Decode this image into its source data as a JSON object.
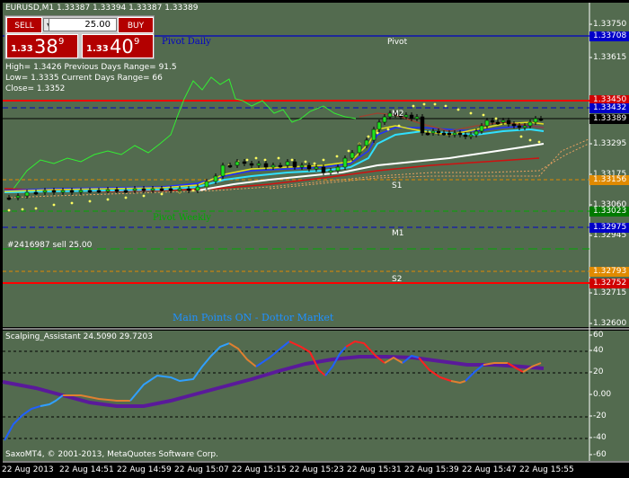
{
  "header": {
    "symbol_line": "EURUSD,M1  1.33387 1.33394 1.33387 1.33389"
  },
  "trade_panel": {
    "sell_label": "SELL",
    "buy_label": "BUY",
    "lots_value": "25.00",
    "sell_price_small": "1.33",
    "sell_price_big": "38",
    "sell_price_sup": "9",
    "buy_price_small": "1.33",
    "buy_price_big": "40",
    "buy_price_sup": "9"
  },
  "info": {
    "line1": "High= 1.3426     Previous Days Range= 91.5",
    "line2": "Low= 1.3335      Current Days Range= 66",
    "line3": "Close= 1.3352"
  },
  "labels": {
    "pivot_daily": "Pivot Daily",
    "pivot": "Pivot",
    "m2": "M2",
    "s1": "S1",
    "pivot_weekly": "Pivot Weekly",
    "m1": "M1",
    "order": "#2416987 sell 25.00",
    "s2": "S2",
    "main_points": "Main Points ON - Dottor Market",
    "indicator": "Scalping_Assistant 24.5090 29.7203",
    "copyright": "SaxoMT4, © 2001-2013, MetaQuotes Software Corp."
  },
  "price_axis": [
    "1.33750",
    "1.33615",
    "1.33295",
    "1.33175",
    "1.33060",
    "1.32945",
    "1.32715",
    "1.32600"
  ],
  "price_badges": [
    {
      "text": "1.33708",
      "bg": "#0000c8"
    },
    {
      "text": "1.33450",
      "bg": "#d00000"
    },
    {
      "text": "1.33432",
      "bg": "#0000c8"
    },
    {
      "text": "1.33389",
      "bg": "#000000"
    },
    {
      "text": "1.33156",
      "bg": "#e08a00"
    },
    {
      "text": "1.33023",
      "bg": "#007a00"
    },
    {
      "text": "1.32975",
      "bg": "#0000c8"
    },
    {
      "text": "1.32793",
      "bg": "#e08a00"
    },
    {
      "text": "1.32752",
      "bg": "#d00000"
    }
  ],
  "indicator_axis": [
    "60",
    "40",
    "20",
    "0.00",
    "-20",
    "-40",
    "-60"
  ],
  "time_axis": [
    "22 Aug 2013",
    "22 Aug 14:51",
    "22 Aug 14:59",
    "22 Aug 15:07",
    "22 Aug 15:15",
    "22 Aug 15:23",
    "22 Aug 15:31",
    "22 Aug 15:39",
    "22 Aug 15:47",
    "22 Aug 15:55"
  ],
  "colors": {
    "chart_bg": "#536b4f",
    "pivot_line": "#0000c8",
    "resistance": "#ff0000",
    "support_orange": "#e08a00",
    "weekly_green": "#00aa00",
    "osc_slow": "#5a1a9a"
  }
}
